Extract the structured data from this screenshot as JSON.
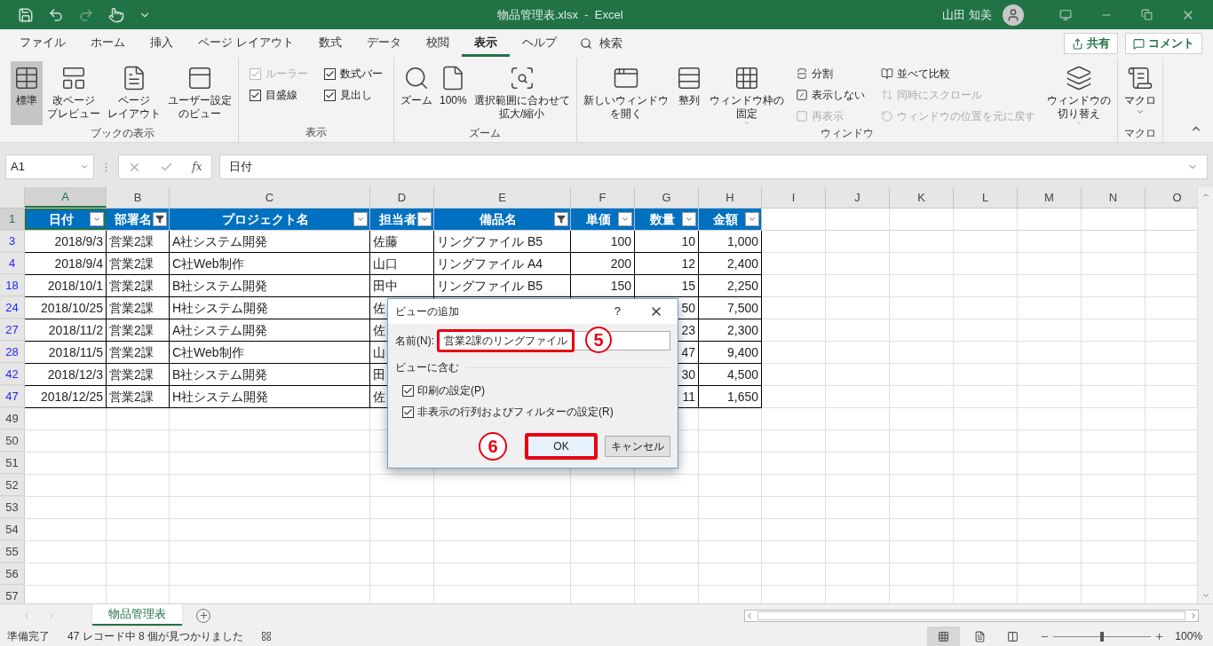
{
  "window": {
    "title": "物品管理表.xlsx  -  Excel",
    "user": "山田 知美"
  },
  "menu_tabs": [
    {
      "label": "ファイル",
      "selected": false
    },
    {
      "label": "ホーム",
      "selected": false
    },
    {
      "label": "挿入",
      "selected": false
    },
    {
      "label": "ページ レイアウト",
      "selected": false
    },
    {
      "label": "数式",
      "selected": false
    },
    {
      "label": "データ",
      "selected": false
    },
    {
      "label": "校閲",
      "selected": false
    },
    {
      "label": "表示",
      "selected": true
    },
    {
      "label": "ヘルプ",
      "selected": false
    }
  ],
  "search": {
    "label": "検索"
  },
  "share_button": "共有",
  "comment_button": "コメント",
  "ribbon_groups": [
    {
      "label": "ブックの表示",
      "items": [
        {
          "kind": "large",
          "label": "標準",
          "selected": true
        },
        {
          "kind": "large",
          "label": [
            "改ページ",
            "プレビュー"
          ],
          "selected": false
        },
        {
          "kind": "large",
          "label": [
            "ページ",
            "レイアウト"
          ],
          "selected": false
        },
        {
          "kind": "large",
          "label": [
            "ユーザー設定",
            "のビュー"
          ],
          "selected": false
        }
      ]
    },
    {
      "label": "表示",
      "items": [
        {
          "kind": "stack",
          "children": [
            {
              "kind": "check",
              "label": "ルーラー",
              "checked": true,
              "disabled": true
            },
            {
              "kind": "check",
              "label": "目盛線",
              "checked": true,
              "disabled": false
            }
          ]
        },
        {
          "kind": "stack",
          "children": [
            {
              "kind": "check",
              "label": "数式バー",
              "checked": true,
              "disabled": false
            },
            {
              "kind": "check",
              "label": "見出し",
              "checked": true,
              "disabled": false
            }
          ]
        }
      ]
    },
    {
      "label": "ズーム",
      "items": [
        {
          "kind": "large",
          "label": "ズーム",
          "selected": false
        },
        {
          "kind": "large",
          "label": "100%",
          "selected": false
        },
        {
          "kind": "large",
          "label": [
            "選択範囲に合わせて",
            "拡大/縮小"
          ],
          "selected": false
        }
      ]
    },
    {
      "label": "ウィンドウ",
      "items": [
        {
          "kind": "large",
          "label": [
            "新しいウィンドウ",
            "を開く"
          ],
          "selected": false
        },
        {
          "kind": "large",
          "label": "整列",
          "selected": false
        },
        {
          "kind": "large",
          "label": [
            "ウィンドウ枠の",
            "固定"
          ],
          "selected": false,
          "dropdown": true
        },
        {
          "kind": "stack",
          "children": [
            {
              "kind": "small",
              "label": "分割",
              "disabled": false
            },
            {
              "kind": "small",
              "label": "表示しない",
              "disabled": false
            },
            {
              "kind": "small",
              "label": "再表示",
              "disabled": true
            }
          ]
        },
        {
          "kind": "stack",
          "children": [
            {
              "kind": "small",
              "label": "並べて比較",
              "disabled": false
            },
            {
              "kind": "small",
              "label": "同時にスクロール",
              "disabled": true
            },
            {
              "kind": "small",
              "label": "ウィンドウの位置を元に戻す",
              "disabled": true
            }
          ]
        },
        {
          "kind": "large",
          "label": [
            "ウィンドウの",
            "切り替え"
          ],
          "selected": false,
          "dropdown": true
        }
      ]
    },
    {
      "label": "マクロ",
      "items": [
        {
          "kind": "large",
          "label": "マクロ",
          "selected": false,
          "dropdown": true
        }
      ]
    }
  ],
  "formula_bar": {
    "name_box": "A1",
    "fx": "fx",
    "value": "日付"
  },
  "columns": [
    {
      "label": "A",
      "selected": true
    },
    {
      "label": "B",
      "selected": false
    },
    {
      "label": "C",
      "selected": false
    },
    {
      "label": "D",
      "selected": false
    },
    {
      "label": "E",
      "selected": false
    },
    {
      "label": "F",
      "selected": false
    },
    {
      "label": "G",
      "selected": false
    },
    {
      "label": "H",
      "selected": false
    },
    {
      "label": "I",
      "selected": false
    },
    {
      "label": "J",
      "selected": false
    },
    {
      "label": "K",
      "selected": false
    },
    {
      "label": "L",
      "selected": false
    },
    {
      "label": "M",
      "selected": false
    },
    {
      "label": "N",
      "selected": false
    },
    {
      "label": "O",
      "selected": false
    }
  ],
  "header_row": {
    "number": "1",
    "selected": true,
    "cells": [
      {
        "text": "日付",
        "filter_active": false
      },
      {
        "text": "部署名",
        "filter_active": true
      },
      {
        "text": "プロジェクト名",
        "filter_active": false
      },
      {
        "text": "担当者",
        "filter_active": false
      },
      {
        "text": "備品名",
        "filter_active": true
      },
      {
        "text": "単価",
        "filter_active": false
      },
      {
        "text": "数量",
        "filter_active": false
      },
      {
        "text": "金額",
        "filter_active": false
      }
    ]
  },
  "rows": [
    {
      "number": "3",
      "filtered": true,
      "cells": [
        "2018/9/3",
        "営業2課",
        "A社システム開発",
        "佐藤",
        "リングファイル B5",
        "100",
        "10",
        "1,000"
      ]
    },
    {
      "number": "4",
      "filtered": true,
      "cells": [
        "2018/9/4",
        "営業2課",
        "C社Web制作",
        "山口",
        "リングファイル A4",
        "200",
        "12",
        "2,400"
      ]
    },
    {
      "number": "18",
      "filtered": true,
      "cells": [
        "2018/10/1",
        "営業2課",
        "B社システム開発",
        "田中",
        "リングファイル B5",
        "150",
        "15",
        "2,250"
      ]
    },
    {
      "number": "24",
      "filtered": true,
      "cells": [
        "2018/10/25",
        "営業2課",
        "H社システム開発",
        "佐",
        null,
        null,
        "50",
        "7,500"
      ]
    },
    {
      "number": "27",
      "filtered": true,
      "cells": [
        "2018/11/2",
        "営業2課",
        "A社システム開発",
        "佐",
        null,
        null,
        "23",
        "2,300"
      ]
    },
    {
      "number": "28",
      "filtered": true,
      "cells": [
        "2018/11/5",
        "営業2課",
        "C社Web制作",
        "山",
        null,
        null,
        "47",
        "9,400"
      ]
    },
    {
      "number": "42",
      "filtered": true,
      "cells": [
        "2018/12/3",
        "営業2課",
        "B社システム開発",
        "田",
        null,
        null,
        "30",
        "4,500"
      ]
    },
    {
      "number": "47",
      "filtered": true,
      "cells": [
        "2018/12/25",
        "営業2課",
        "H社システム開発",
        "佐",
        null,
        null,
        "11",
        "1,650"
      ]
    },
    {
      "number": "49",
      "filtered": false,
      "cells": []
    },
    {
      "number": "50",
      "filtered": false,
      "cells": []
    },
    {
      "number": "51",
      "filtered": false,
      "cells": []
    },
    {
      "number": "52",
      "filtered": false,
      "cells": []
    },
    {
      "number": "53",
      "filtered": false,
      "cells": []
    },
    {
      "number": "54",
      "filtered": false,
      "cells": []
    },
    {
      "number": "55",
      "filtered": false,
      "cells": []
    },
    {
      "number": "56",
      "filtered": false,
      "cells": []
    },
    {
      "number": "57",
      "filtered": false,
      "cells": []
    }
  ],
  "dialog": {
    "title": "ビューの追加",
    "help": "?",
    "name_label": "名前(N):",
    "name_value": "営業2課のリングファイル",
    "name_callout": "5",
    "section": "ビューに含む",
    "options": [
      {
        "label": "印刷の設定(P)",
        "checked": true
      },
      {
        "label": "非表示の行列およびフィルターの設定(R)",
        "checked": true
      }
    ],
    "ok": "OK",
    "ok_callout": "6",
    "cancel": "キャンセル"
  },
  "sheet_tabs": [
    {
      "label": "物品管理表",
      "selected": true
    }
  ],
  "status_bar": {
    "ready": "準備完了",
    "message": "47 レコード中 8 個が見つかりました",
    "zoom": "100%",
    "zoom_slider": {
      "level": 0.5
    }
  }
}
